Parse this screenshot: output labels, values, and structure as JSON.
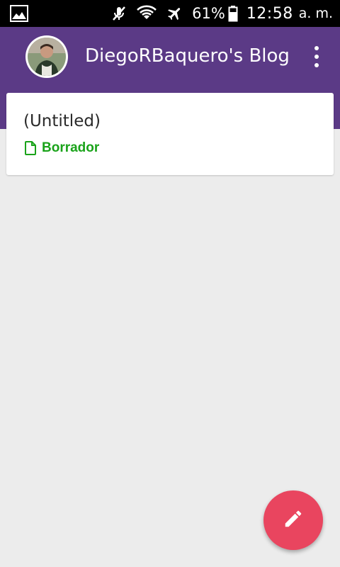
{
  "status_bar": {
    "battery": "61%",
    "time": "12:58",
    "ampm": "a. m."
  },
  "header": {
    "title": "DiegoRBaquero's Blog"
  },
  "posts": [
    {
      "title": "(Untitled)",
      "status": "Borrador"
    }
  ],
  "colors": {
    "header": "#5b3a86",
    "fab": "#e9455f",
    "draft_status": "#1aa31a",
    "background": "#ececec"
  },
  "icons": {
    "status_left": "image-icon",
    "status_right": [
      "muted-icon",
      "wifi-icon",
      "airplane-mode-icon",
      "battery-icon"
    ],
    "header_menu": "overflow-menu-icon",
    "post_status": "document-icon",
    "fab": "pencil-icon"
  }
}
